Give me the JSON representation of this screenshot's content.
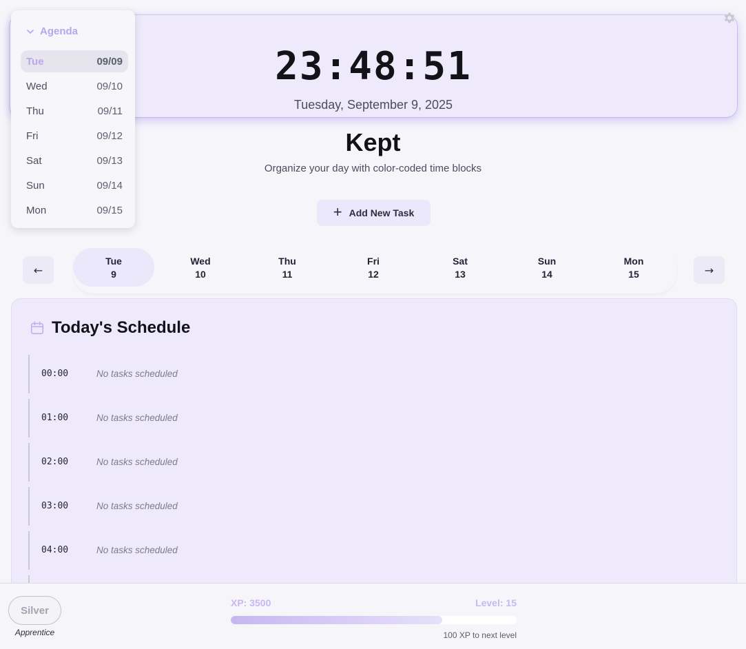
{
  "clock": {
    "time": "23:48:51",
    "date": "Tuesday, September 9, 2025"
  },
  "agenda": {
    "title": "Agenda",
    "items": [
      {
        "day": "Tue",
        "date": "09/09"
      },
      {
        "day": "Wed",
        "date": "09/10"
      },
      {
        "day": "Thu",
        "date": "09/11"
      },
      {
        "day": "Fri",
        "date": "09/12"
      },
      {
        "day": "Sat",
        "date": "09/13"
      },
      {
        "day": "Sun",
        "date": "09/14"
      },
      {
        "day": "Mon",
        "date": "09/15"
      }
    ]
  },
  "app": {
    "title": "Kept",
    "subtitle": "Organize your day with color-coded time blocks",
    "add_task_label": "Add New Task"
  },
  "week": {
    "prev_label": "←",
    "next_label": "→",
    "days": [
      {
        "name": "Tue",
        "num": "9"
      },
      {
        "name": "Wed",
        "num": "10"
      },
      {
        "name": "Thu",
        "num": "11"
      },
      {
        "name": "Fri",
        "num": "12"
      },
      {
        "name": "Sat",
        "num": "13"
      },
      {
        "name": "Sun",
        "num": "14"
      },
      {
        "name": "Mon",
        "num": "15"
      }
    ]
  },
  "schedule": {
    "title": "Today's Schedule",
    "slots": [
      {
        "time": "00:00",
        "text": "No tasks scheduled"
      },
      {
        "time": "01:00",
        "text": "No tasks scheduled"
      },
      {
        "time": "02:00",
        "text": "No tasks scheduled"
      },
      {
        "time": "03:00",
        "text": "No tasks scheduled"
      },
      {
        "time": "04:00",
        "text": "No tasks scheduled"
      }
    ]
  },
  "footer": {
    "rank": "Silver",
    "rank_title": "Apprentice",
    "xp_label": "XP: 3500",
    "level_label": "Level: 15",
    "xp_progress": 0.74,
    "next_level_text": "100 XP to next level"
  },
  "colors": {
    "accent": "#c6b6f1",
    "card_bg": "#eeeafb",
    "page_bg": "#f6f5fa"
  }
}
